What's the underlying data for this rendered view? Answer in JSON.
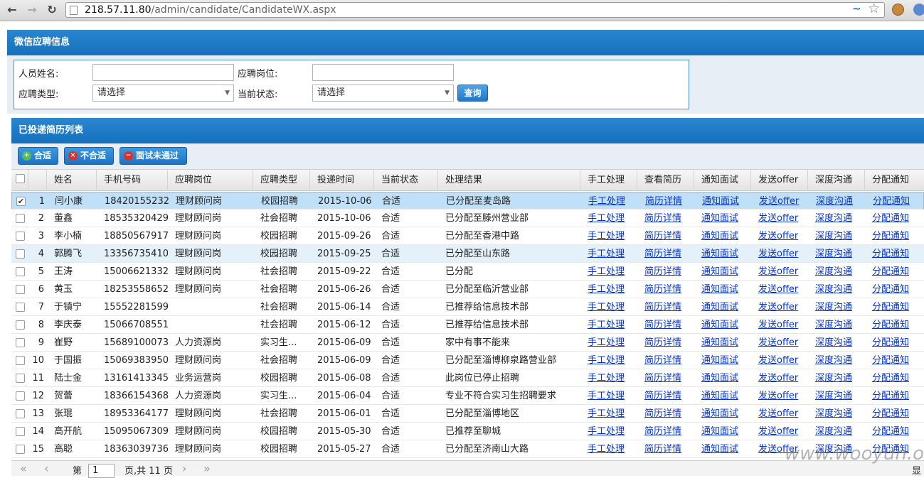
{
  "browser": {
    "url_host": "218.57.11.80",
    "url_path": "/admin/candidate/CandidateWX.aspx"
  },
  "search_panel": {
    "title": "微信应聘信息",
    "name_label": "人员姓名:",
    "name_value": "",
    "position_label": "应聘岗位:",
    "position_value": "",
    "type_label": "应聘类型:",
    "type_selected": "请选择",
    "status_label": "当前状态:",
    "status_selected": "请选择",
    "query_label": "查询"
  },
  "list_panel": {
    "title": "已投递简历列表",
    "btn_pass": "合适",
    "btn_fail": "不合适",
    "btn_interview_fail": "面试未通过"
  },
  "columns": [
    "姓名",
    "手机号码",
    "应聘岗位",
    "应聘类型",
    "投递时间",
    "当前状态",
    "处理结果",
    "手工处理",
    "查看简历",
    "通知面试",
    "发送offer",
    "深度沟通",
    "分配通知"
  ],
  "link_labels": {
    "manual": "手工处理",
    "resume": "简历详情",
    "interview": "通知面试",
    "offer": "发送offer",
    "deep": "深度沟通",
    "assign": "分配通知"
  },
  "rows": [
    {
      "no": "1",
      "checked": "✔",
      "name": "闫小康",
      "phone": "18420155232",
      "position": "理财顾问岗",
      "type": "校园招聘",
      "date": "2015-10-06",
      "status": "合适",
      "result": "已分配至麦岛路"
    },
    {
      "no": "2",
      "checked": "",
      "name": "董鑫",
      "phone": "18535320429",
      "position": "理财顾问岗",
      "type": "社会招聘",
      "date": "2015-10-06",
      "status": "合适",
      "result": "已分配至滕州营业部"
    },
    {
      "no": "3",
      "checked": "",
      "name": "李小楠",
      "phone": "18850567917",
      "position": "理财顾问岗",
      "type": "校园招聘",
      "date": "2015-09-26",
      "status": "合适",
      "result": "已分配至香港中路"
    },
    {
      "no": "4",
      "checked": "",
      "name": "郭腾飞",
      "phone": "13356735410",
      "position": "理财顾问岗",
      "type": "校园招聘",
      "date": "2015-09-25",
      "status": "合适",
      "result": "已分配至山东路"
    },
    {
      "no": "5",
      "checked": "",
      "name": "王涛",
      "phone": "15006621332",
      "position": "理财顾问岗",
      "type": "社会招聘",
      "date": "2015-09-22",
      "status": "合适",
      "result": "已分配"
    },
    {
      "no": "6",
      "checked": "",
      "name": "黄玉",
      "phone": "18253558652",
      "position": "理财顾问岗",
      "type": "社会招聘",
      "date": "2015-06-26",
      "status": "合适",
      "result": "已分配至临沂营业部"
    },
    {
      "no": "7",
      "checked": "",
      "name": "于镇宁",
      "phone": "15552281599",
      "position": "",
      "type": "社会招聘",
      "date": "2015-06-14",
      "status": "合适",
      "result": "已推荐给信息技术部"
    },
    {
      "no": "8",
      "checked": "",
      "name": "李庆泰",
      "phone": "15066708551",
      "position": "",
      "type": "社会招聘",
      "date": "2015-06-12",
      "status": "合适",
      "result": "已推荐给信息技术部"
    },
    {
      "no": "9",
      "checked": "",
      "name": "崔野",
      "phone": "15689100073",
      "position": "人力资源岗",
      "type": "实习生...",
      "date": "2015-06-09",
      "status": "合适",
      "result": "家中有事不能来"
    },
    {
      "no": "10",
      "checked": "",
      "name": "于国振",
      "phone": "15069383950",
      "position": "理财顾问岗",
      "type": "社会招聘",
      "date": "2015-06-09",
      "status": "合适",
      "result": "已分配至淄博柳泉路营业部"
    },
    {
      "no": "11",
      "checked": "",
      "name": "陆士金",
      "phone": "13161413345",
      "position": "业务运营岗",
      "type": "校园招聘",
      "date": "2015-06-08",
      "status": "合适",
      "result": "此岗位已停止招聘"
    },
    {
      "no": "12",
      "checked": "",
      "name": "贺蕾",
      "phone": "18366154368",
      "position": "人力资源岗",
      "type": "实习生...",
      "date": "2015-06-04",
      "status": "合适",
      "result": "专业不符合实习生招聘要求"
    },
    {
      "no": "13",
      "checked": "",
      "name": "张琨",
      "phone": "18953364177",
      "position": "理财顾问岗",
      "type": "社会招聘",
      "date": "2015-06-01",
      "status": "合适",
      "result": "已分配至淄博地区"
    },
    {
      "no": "14",
      "checked": "",
      "name": "高开航",
      "phone": "15095067309",
      "position": "理财顾问岗",
      "type": "校园招聘",
      "date": "2015-05-30",
      "status": "合适",
      "result": "已推荐至聊城"
    },
    {
      "no": "15",
      "checked": "",
      "name": "高聪",
      "phone": "18363039736",
      "position": "理财顾问岗",
      "type": "校园招聘",
      "date": "2015-05-27",
      "status": "合适",
      "result": "已分配至济南山大路"
    }
  ],
  "pager": {
    "prefix": "第",
    "page_value": "1",
    "suffix": "页,共 11 页",
    "right_text": "显"
  },
  "watermark": "www.wooyun.org"
}
